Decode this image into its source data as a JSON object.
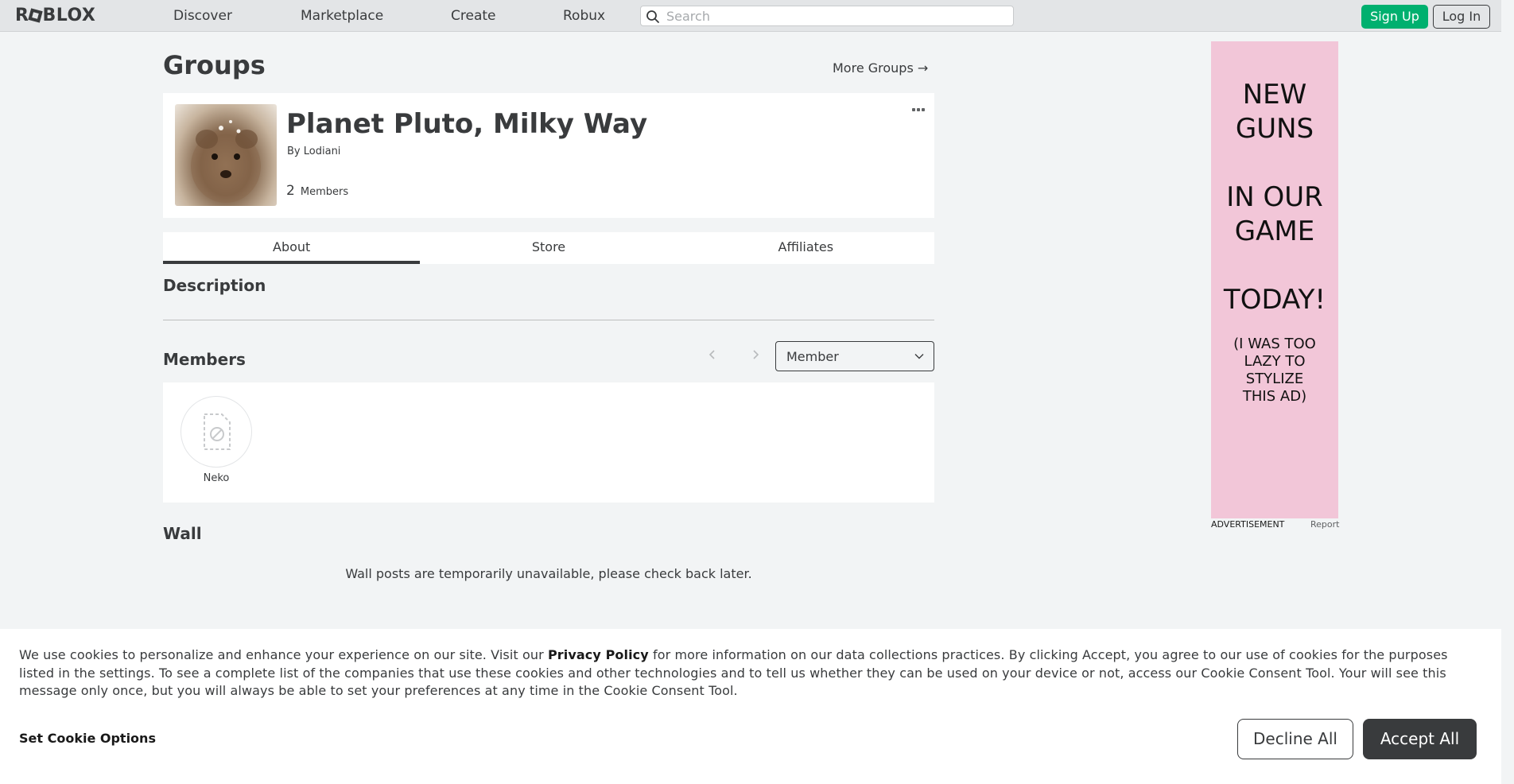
{
  "nav": {
    "logo": "ROBLOX",
    "logo_pre": "R",
    "logo_post": "BLOX",
    "links": [
      "Discover",
      "Marketplace",
      "Create",
      "Robux"
    ],
    "search_placeholder": "Search",
    "signup_label": "Sign Up",
    "login_label": "Log In"
  },
  "page": {
    "title": "Groups",
    "more_groups": "More Groups →"
  },
  "group": {
    "name": "Planet Pluto, Milky Way",
    "by_label": "By",
    "owner": "Lodiani",
    "member_count": "2",
    "members_label": "Members"
  },
  "tabs": [
    "About",
    "Store",
    "Affiliates"
  ],
  "active_tab": "About",
  "about": {
    "description_title": "Description",
    "members_title": "Members",
    "role_selected": "Member",
    "members": [
      {
        "name": "Neko"
      }
    ],
    "wall_title": "Wall",
    "wall_message": "Wall posts are temporarily unavailable, please check back later."
  },
  "ad": {
    "line1": "NEW",
    "line2": "GUNS",
    "line3": "IN OUR",
    "line4": "GAME",
    "line5": "TODAY!",
    "line6": "(I WAS TOO",
    "line7": "LAZY TO",
    "line8": "STYLIZE",
    "line9": "THIS AD)",
    "label": "ADVERTISEMENT",
    "report": "Report",
    "background": "#f2c6d8"
  },
  "cookie": {
    "text_before": "We use cookies to personalize and enhance your experience on our site. Visit our ",
    "privacy_link": "Privacy Policy",
    "text_after": " for more information on our data collections practices. By clicking Accept, you agree to our use of cookies for the purposes listed in the settings. To see a complete list of the companies that use these cookies and other technologies and to tell us whether they can be used on your device or not, access our Cookie Consent Tool. Your will see this message only once, but you will always be able to set your preferences at any time in the Cookie Consent Tool.",
    "set_options": "Set Cookie Options",
    "decline": "Decline All",
    "accept": "Accept All"
  },
  "colors": {
    "signup_green": "#00b06f",
    "text_dark": "#393b3d",
    "page_bg": "#f2f4f5"
  }
}
